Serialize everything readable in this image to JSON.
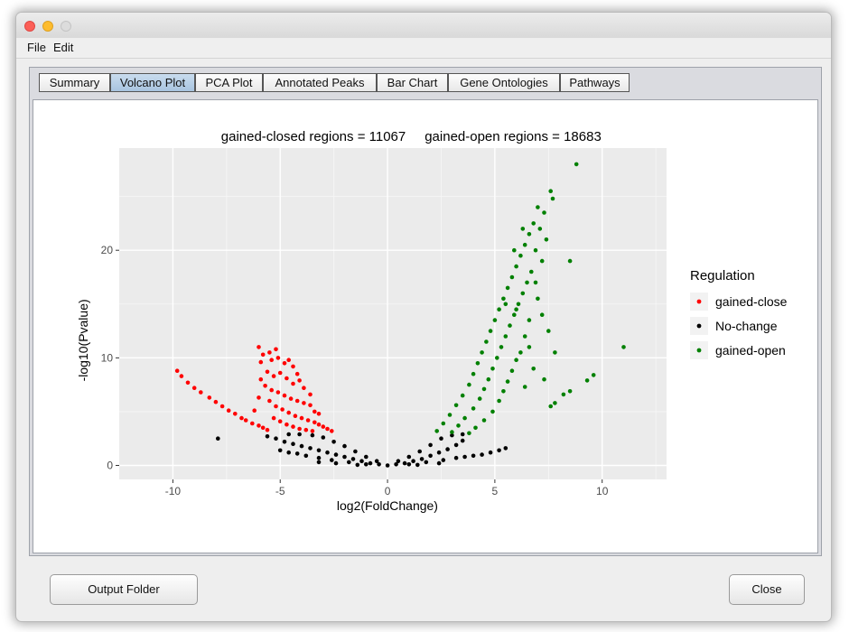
{
  "window": {
    "menu": [
      "File",
      "Edit"
    ]
  },
  "tabs": [
    {
      "label": "Summary",
      "active": false
    },
    {
      "label": "Volcano Plot",
      "active": true
    },
    {
      "label": "PCA Plot",
      "active": false
    },
    {
      "label": "Annotated Peaks",
      "active": false
    },
    {
      "label": "Bar Chart",
      "active": false
    },
    {
      "label": "Gene Ontologies",
      "active": false
    },
    {
      "label": "Pathways",
      "active": false
    }
  ],
  "buttons": {
    "output_folder": "Output Folder",
    "close": "Close"
  },
  "colors": {
    "gained_close": "#ff0000",
    "no_change": "#000000",
    "gained_open": "#008000",
    "panel_bg": "#ebebeb"
  },
  "chart_data": {
    "type": "scatter",
    "title_left": "gained-closed regions = 11067",
    "title_right": "gained-open regions = 18683",
    "xlabel": "log2(FoldChange)",
    "ylabel": "-log10(Pvalue)",
    "xlim": [
      -12.5,
      13
    ],
    "ylim": [
      -1.3,
      29.5
    ],
    "xticks": [
      -10,
      -5,
      0,
      5,
      10
    ],
    "yticks": [
      0,
      10,
      20
    ],
    "grid": true,
    "legend": {
      "title": "Regulation",
      "placement": "right",
      "entries": [
        "gained-close",
        "No-change",
        "gained-open"
      ]
    },
    "series": [
      {
        "name": "gained-close",
        "color": "#ff0000",
        "points": [
          [
            -9.8,
            8.8
          ],
          [
            -9.6,
            8.3
          ],
          [
            -9.3,
            7.7
          ],
          [
            -9.0,
            7.2
          ],
          [
            -8.7,
            6.8
          ],
          [
            -8.3,
            6.3
          ],
          [
            -8.0,
            5.9
          ],
          [
            -7.7,
            5.5
          ],
          [
            -7.4,
            5.1
          ],
          [
            -7.1,
            4.8
          ],
          [
            -6.8,
            4.4
          ],
          [
            -6.6,
            4.2
          ],
          [
            -6.3,
            3.9
          ],
          [
            -6.0,
            3.7
          ],
          [
            -5.8,
            3.5
          ],
          [
            -5.6,
            3.3
          ],
          [
            -6.0,
            11.0
          ],
          [
            -5.8,
            10.3
          ],
          [
            -5.9,
            9.6
          ],
          [
            -5.5,
            10.5
          ],
          [
            -5.2,
            10.8
          ],
          [
            -5.4,
            9.8
          ],
          [
            -5.1,
            10.0
          ],
          [
            -4.8,
            9.5
          ],
          [
            -4.6,
            9.8
          ],
          [
            -4.4,
            9.2
          ],
          [
            -5.6,
            8.7
          ],
          [
            -5.3,
            8.3
          ],
          [
            -5.0,
            8.6
          ],
          [
            -4.7,
            8.1
          ],
          [
            -4.4,
            7.6
          ],
          [
            -4.1,
            7.9
          ],
          [
            -3.9,
            7.2
          ],
          [
            -5.7,
            7.4
          ],
          [
            -5.4,
            7.0
          ],
          [
            -5.1,
            6.8
          ],
          [
            -4.8,
            6.5
          ],
          [
            -4.5,
            6.2
          ],
          [
            -4.2,
            6.0
          ],
          [
            -3.9,
            5.8
          ],
          [
            -3.6,
            5.6
          ],
          [
            -3.4,
            5.0
          ],
          [
            -5.5,
            6.0
          ],
          [
            -5.2,
            5.5
          ],
          [
            -4.9,
            5.2
          ],
          [
            -4.6,
            4.9
          ],
          [
            -4.3,
            4.6
          ],
          [
            -4.0,
            4.4
          ],
          [
            -3.7,
            4.2
          ],
          [
            -3.4,
            4.0
          ],
          [
            -3.2,
            3.8
          ],
          [
            -3.0,
            3.6
          ],
          [
            -2.8,
            3.4
          ],
          [
            -2.6,
            3.2
          ],
          [
            -5.3,
            4.4
          ],
          [
            -5.0,
            4.1
          ],
          [
            -4.7,
            3.8
          ],
          [
            -4.4,
            3.6
          ],
          [
            -4.1,
            3.4
          ],
          [
            -3.8,
            3.3
          ],
          [
            -3.5,
            3.2
          ],
          [
            -6.2,
            5.1
          ],
          [
            -6.0,
            6.3
          ],
          [
            -5.9,
            8.0
          ],
          [
            -4.2,
            8.5
          ],
          [
            -3.6,
            6.6
          ],
          [
            -3.2,
            4.8
          ]
        ]
      },
      {
        "name": "No-change",
        "color": "#000000",
        "points": [
          [
            -7.9,
            2.5
          ],
          [
            -5.6,
            2.7
          ],
          [
            -5.2,
            2.5
          ],
          [
            -4.8,
            2.2
          ],
          [
            -4.4,
            2.0
          ],
          [
            -4.0,
            1.8
          ],
          [
            -3.6,
            1.6
          ],
          [
            -3.2,
            1.4
          ],
          [
            -2.8,
            1.2
          ],
          [
            -2.4,
            1.0
          ],
          [
            -2.0,
            0.8
          ],
          [
            -1.6,
            0.6
          ],
          [
            -1.2,
            0.4
          ],
          [
            -0.8,
            0.2
          ],
          [
            -0.4,
            0.1
          ],
          [
            0.0,
            0.0
          ],
          [
            0.4,
            0.1
          ],
          [
            0.8,
            0.2
          ],
          [
            1.2,
            0.4
          ],
          [
            1.6,
            0.6
          ],
          [
            2.0,
            0.9
          ],
          [
            2.4,
            1.2
          ],
          [
            2.8,
            1.5
          ],
          [
            3.2,
            1.9
          ],
          [
            3.5,
            2.3
          ],
          [
            -4.6,
            2.9
          ],
          [
            -4.1,
            2.9
          ],
          [
            -3.5,
            2.8
          ],
          [
            -3.0,
            2.6
          ],
          [
            -2.5,
            2.2
          ],
          [
            -2.0,
            1.8
          ],
          [
            -1.5,
            1.3
          ],
          [
            -1.0,
            0.8
          ],
          [
            -0.5,
            0.4
          ],
          [
            0.5,
            0.4
          ],
          [
            1.0,
            0.8
          ],
          [
            1.5,
            1.3
          ],
          [
            2.0,
            1.9
          ],
          [
            2.5,
            2.5
          ],
          [
            3.0,
            2.8
          ],
          [
            3.5,
            2.9
          ],
          [
            -5.0,
            1.4
          ],
          [
            -4.6,
            1.2
          ],
          [
            -4.2,
            1.1
          ],
          [
            -3.8,
            0.9
          ],
          [
            -3.2,
            0.7
          ],
          [
            -2.6,
            0.5
          ],
          [
            -1.8,
            0.3
          ],
          [
            -1.0,
            0.1
          ],
          [
            1.0,
            0.1
          ],
          [
            1.8,
            0.3
          ],
          [
            2.6,
            0.5
          ],
          [
            3.2,
            0.7
          ],
          [
            3.6,
            0.8
          ],
          [
            4.0,
            0.9
          ],
          [
            4.4,
            1.0
          ],
          [
            4.8,
            1.2
          ],
          [
            5.2,
            1.4
          ],
          [
            5.5,
            1.6
          ],
          [
            -3.2,
            0.3
          ],
          [
            -2.4,
            0.2
          ],
          [
            2.4,
            0.2
          ],
          [
            1.4,
            0.05
          ],
          [
            -1.4,
            0.05
          ]
        ]
      },
      {
        "name": "gained-open",
        "color": "#008000",
        "points": [
          [
            8.8,
            28.0
          ],
          [
            7.6,
            25.5
          ],
          [
            7.7,
            24.8
          ],
          [
            7.0,
            24.0
          ],
          [
            7.3,
            23.5
          ],
          [
            6.8,
            22.5
          ],
          [
            7.1,
            22.0
          ],
          [
            6.6,
            21.5
          ],
          [
            7.4,
            21.0
          ],
          [
            6.4,
            20.5
          ],
          [
            6.9,
            20.0
          ],
          [
            6.2,
            19.5
          ],
          [
            8.5,
            19.0
          ],
          [
            6.0,
            18.5
          ],
          [
            6.7,
            18.0
          ],
          [
            5.8,
            17.5
          ],
          [
            6.5,
            17.0
          ],
          [
            5.6,
            16.5
          ],
          [
            6.3,
            16.0
          ],
          [
            5.4,
            15.5
          ],
          [
            6.1,
            15.0
          ],
          [
            7.0,
            15.5
          ],
          [
            5.2,
            14.5
          ],
          [
            5.9,
            14.0
          ],
          [
            7.2,
            14.0
          ],
          [
            5.0,
            13.5
          ],
          [
            5.7,
            13.0
          ],
          [
            6.6,
            13.5
          ],
          [
            4.8,
            12.5
          ],
          [
            5.5,
            12.0
          ],
          [
            6.4,
            12.0
          ],
          [
            7.5,
            12.5
          ],
          [
            4.6,
            11.5
          ],
          [
            5.3,
            11.0
          ],
          [
            6.2,
            10.5
          ],
          [
            11.0,
            11.0
          ],
          [
            4.4,
            10.5
          ],
          [
            5.1,
            10.0
          ],
          [
            6.0,
            9.8
          ],
          [
            7.8,
            10.5
          ],
          [
            4.2,
            9.5
          ],
          [
            4.9,
            9.0
          ],
          [
            5.8,
            8.8
          ],
          [
            6.8,
            9.0
          ],
          [
            4.0,
            8.5
          ],
          [
            4.7,
            8.0
          ],
          [
            5.6,
            7.8
          ],
          [
            9.6,
            8.4
          ],
          [
            9.3,
            7.9
          ],
          [
            3.8,
            7.5
          ],
          [
            4.5,
            7.1
          ],
          [
            5.4,
            6.9
          ],
          [
            6.4,
            7.3
          ],
          [
            3.5,
            6.5
          ],
          [
            4.3,
            6.2
          ],
          [
            5.2,
            6.0
          ],
          [
            8.2,
            6.6
          ],
          [
            8.5,
            6.9
          ],
          [
            3.2,
            5.6
          ],
          [
            4.0,
            5.3
          ],
          [
            4.9,
            5.0
          ],
          [
            7.8,
            5.8
          ],
          [
            7.6,
            5.5
          ],
          [
            2.9,
            4.7
          ],
          [
            3.6,
            4.4
          ],
          [
            4.5,
            4.2
          ],
          [
            2.6,
            3.9
          ],
          [
            3.3,
            3.7
          ],
          [
            4.1,
            3.5
          ],
          [
            2.3,
            3.2
          ],
          [
            3.0,
            3.1
          ],
          [
            3.8,
            3.0
          ],
          [
            7.3,
            8.0
          ],
          [
            6.6,
            11.0
          ],
          [
            6.0,
            14.5
          ],
          [
            5.5,
            15.0
          ],
          [
            6.9,
            17.0
          ],
          [
            7.2,
            19.0
          ],
          [
            6.3,
            22.0
          ],
          [
            5.9,
            20.0
          ]
        ]
      }
    ]
  }
}
